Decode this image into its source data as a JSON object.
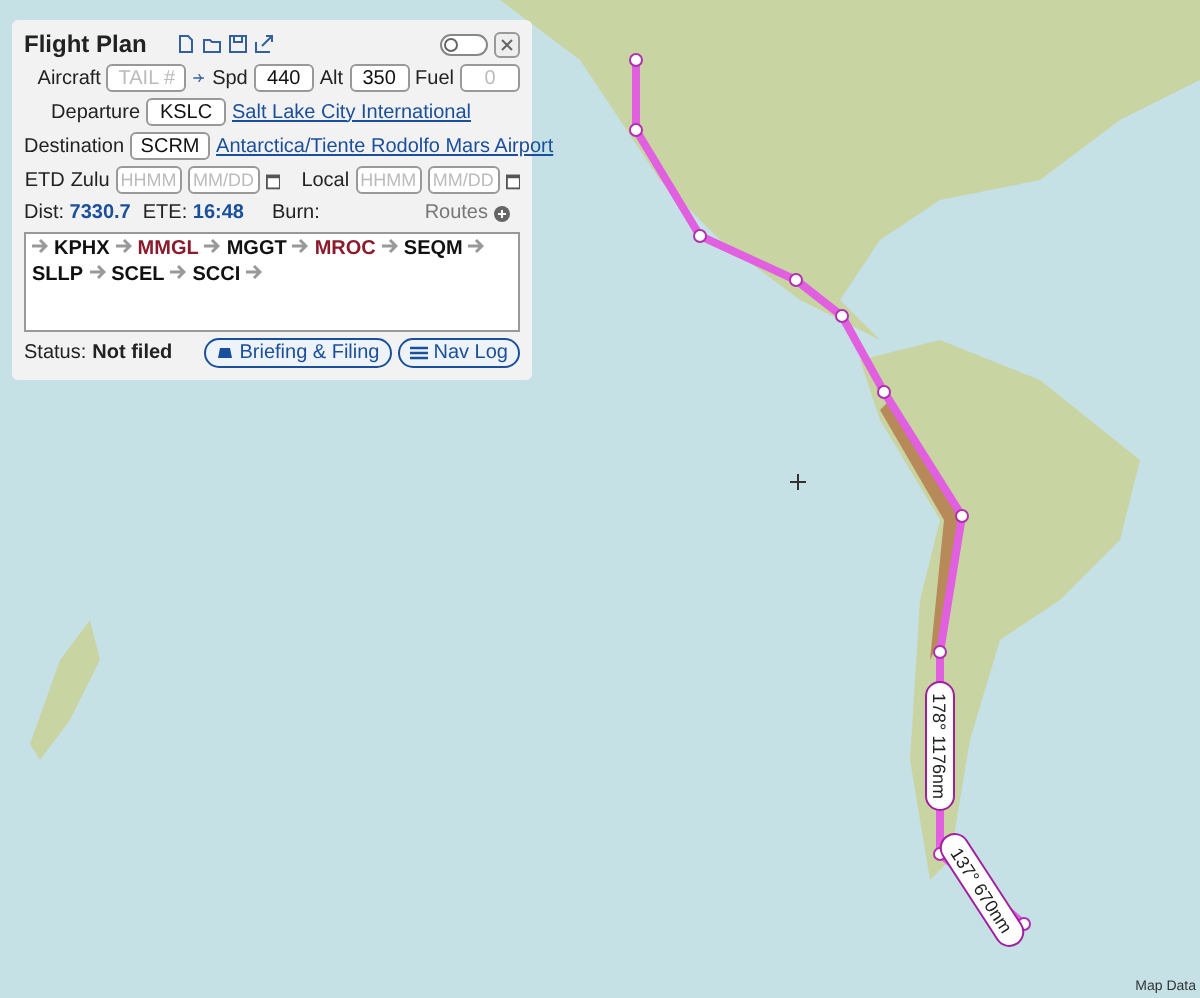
{
  "flight_plan": {
    "title": "Flight Plan",
    "toggle_on": false,
    "aircraft": {
      "label": "Aircraft",
      "tail_placeholder": "TAIL #",
      "spd_label": "Spd",
      "spd": "440",
      "alt_label": "Alt",
      "alt": "350",
      "fuel_label": "Fuel",
      "fuel_placeholder": "0"
    },
    "departure": {
      "label": "Departure",
      "code": "KSLC",
      "name": "Salt Lake City International"
    },
    "destination": {
      "label": "Destination",
      "code": "SCRM",
      "name": "Antarctica/Tiente Rodolfo Mars Airport"
    },
    "etd": {
      "label": "ETD",
      "zulu_label": "Zulu",
      "zulu_time_placeholder": "HHMM",
      "zulu_date_placeholder": "MM/DD",
      "local_label": "Local",
      "local_time_placeholder": "HHMM",
      "local_date_placeholder": "MM/DD"
    },
    "dist_label": "Dist:",
    "dist": "7330.7",
    "ete_label": "ETE:",
    "ete": "16:48",
    "burn_label": "Burn:",
    "routes_label": "Routes",
    "route": [
      {
        "code": "KPHX",
        "color": "#111111"
      },
      {
        "code": "MMGL",
        "color": "#8b1a2b"
      },
      {
        "code": "MGGT",
        "color": "#111111"
      },
      {
        "code": "MROC",
        "color": "#8b1a2b"
      },
      {
        "code": "SEQM",
        "color": "#111111"
      },
      {
        "code": "SLLP",
        "color": "#111111"
      },
      {
        "code": "SCEL",
        "color": "#111111"
      },
      {
        "code": "SCCI",
        "color": "#111111"
      }
    ],
    "status_label": "Status:",
    "status": "Not filed",
    "buttons": [
      "Briefing & Filing",
      "Nav Log"
    ]
  },
  "map": {
    "leg_labels": [
      "178° 1176nm",
      "137° 670nm"
    ],
    "attribution": "Map Data"
  }
}
